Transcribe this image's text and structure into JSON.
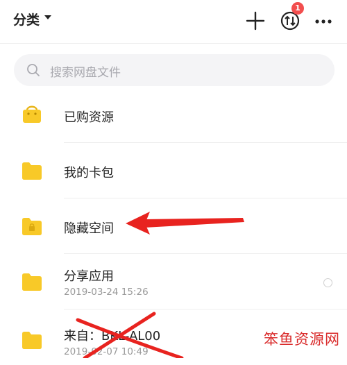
{
  "header": {
    "category_label": "分类",
    "upload_badge": "1"
  },
  "search": {
    "placeholder": "搜索网盘文件"
  },
  "items": [
    {
      "title": "已购资源",
      "subtitle": ""
    },
    {
      "title": "我的卡包",
      "subtitle": ""
    },
    {
      "title": "隐藏空间",
      "subtitle": ""
    },
    {
      "title": "分享应用",
      "subtitle": "2019-03-24  15:26"
    },
    {
      "title": "来自：BKL-AL00",
      "subtitle": "2019-02-07  10:49"
    }
  ],
  "watermark": "笨鱼资源网",
  "colors": {
    "folder": "#f8c928",
    "annotation_red": "#e8231f",
    "badge": "#f24e4e"
  }
}
